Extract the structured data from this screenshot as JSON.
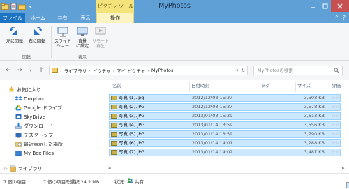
{
  "window": {
    "title": "MyPhotos",
    "contextual_tab_group": "ピクチャ ツール"
  },
  "ribbon_tabs": {
    "file": "ファイル",
    "home": "ホーム",
    "share": "共有",
    "view": "表示",
    "manage": "操作"
  },
  "ribbon": {
    "rotate_left": "左に回転",
    "rotate_right": "右に回転",
    "rotate_group": "回転",
    "slideshow": "スライド\nショー",
    "set_background": "背景\nに設定",
    "remote_play": "リモート\n再生",
    "view_group": "表示"
  },
  "address": {
    "crumbs": [
      "ライブラリ",
      "ピクチャ",
      "マイ ピクチャ",
      "MyPhotos"
    ],
    "search_placeholder": "MyPhotosの検索"
  },
  "nav": {
    "favorites": "お気に入り",
    "items": [
      "Dropbox",
      "Google ドライブ",
      "SkyDrive",
      "ダウンロード",
      "デスクトップ",
      "最近表示した場所",
      "My Box Files"
    ],
    "libraries": "ライブラリ"
  },
  "columns": {
    "name": "名前",
    "date": "日付時刻",
    "tag": "タグ",
    "size": "サイズ",
    "rating": "評価"
  },
  "files": [
    {
      "name": "写真 (1).jpg",
      "date": "2012/12/08 15:37",
      "size": "3,508 KB"
    },
    {
      "name": "写真 (2).JPG",
      "date": "2012/12/08 15:37",
      "size": "3,578 KB"
    },
    {
      "name": "写真 (3).JPG",
      "date": "2013/01/08 15:39",
      "size": "3,613 KB"
    },
    {
      "name": "写真 (4).JPG",
      "date": "2013/01/14 13:59",
      "size": "3,556 KB"
    },
    {
      "name": "写真 (5).JPG",
      "date": "2013/01/14 13:59",
      "size": "3,790 KB"
    },
    {
      "name": "写真 (6).JPG",
      "date": "2013/01/14 14:01",
      "size": "3,288 KB"
    },
    {
      "name": "写真 (7).JPG",
      "date": "2013/01/14 14:02",
      "size": "3,487 KB"
    }
  ],
  "status": {
    "item_count": "7 個の項目",
    "selected": "7 個の項目を選択  24.2 MB",
    "state_label": "状況:",
    "state_value": "共有"
  },
  "colors": {
    "titlebar": "#5fa1d6",
    "file_tab": "#1c74c2",
    "contextual": "#f3e37a",
    "selection": "#cce8ff"
  }
}
